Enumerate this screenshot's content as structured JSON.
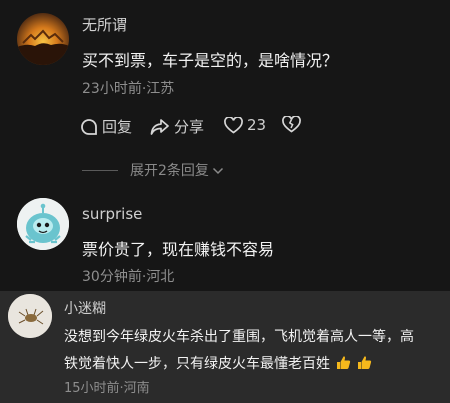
{
  "comments": [
    {
      "user": "无所谓",
      "text": "买不到票，车子是空的，是啥情况？",
      "meta": "23小时前·江苏",
      "actions": {
        "reply": "回复",
        "share": "分享",
        "likes": "23"
      },
      "expand": "展开2条回复"
    },
    {
      "user": "surprise",
      "text": "票价贵了，现在赚钱不容易",
      "meta": "30分钟前·河北"
    },
    {
      "user": "小迷糊",
      "text_line1": "没想到今年绿皮火车杀出了重围，飞机觉着高人一等，高",
      "text_line2": "铁觉着快人一步，只有绿皮火车最懂老百姓",
      "meta": "15小时前·河南"
    }
  ],
  "colors": {
    "accent_thumb": "#f5b81c"
  },
  "icons": [
    "avatar-sunset",
    "reply-icon",
    "share-icon",
    "heart-icon",
    "broken-heart-icon",
    "chevron-down-icon",
    "avatar-robot",
    "avatar-bug",
    "thumbs-up-emoji"
  ]
}
